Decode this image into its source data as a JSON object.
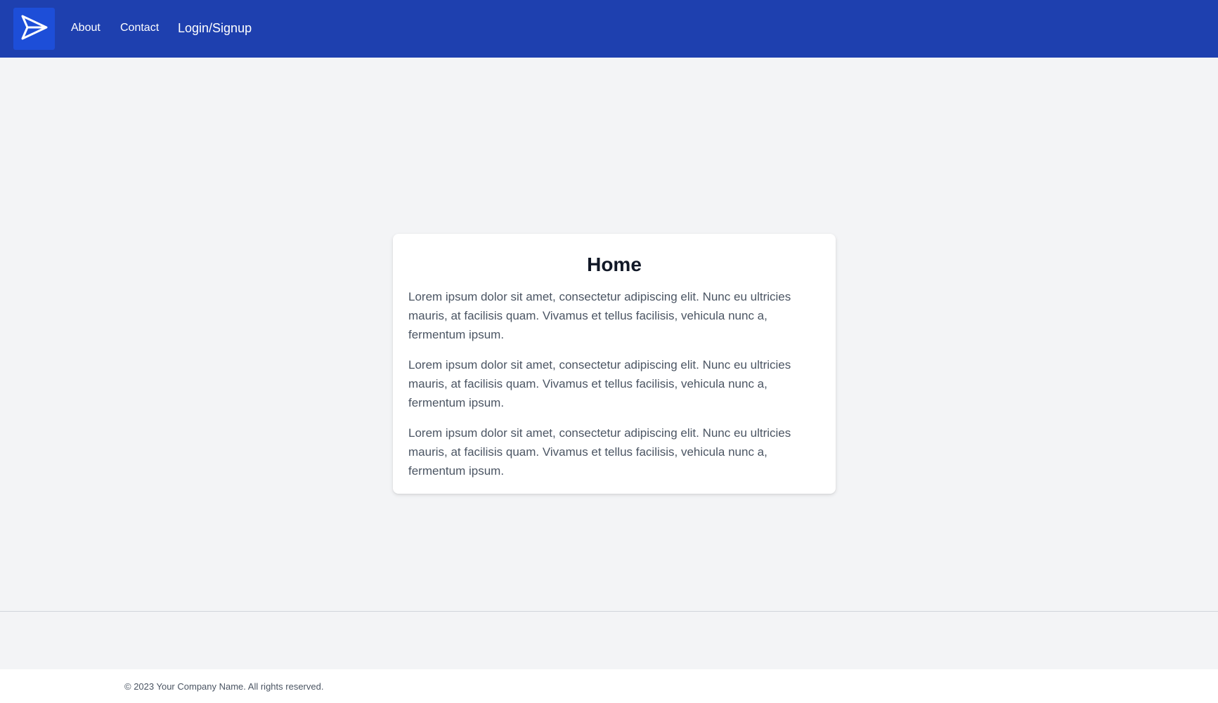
{
  "header": {
    "brand_color": "#1e40af",
    "logo_icon": "paper-plane-icon",
    "nav": {
      "about": "About",
      "contact": "Contact",
      "login_signup": "Login/Signup"
    }
  },
  "main": {
    "title": "Home",
    "paragraphs": [
      "Lorem ipsum dolor sit amet, consectetur adipiscing elit. Nunc eu ultricies mauris, at facilisis quam. Vivamus et tellus facilisis, vehicula nunc a, fermentum ipsum.",
      "Lorem ipsum dolor sit amet, consectetur adipiscing elit. Nunc eu ultricies mauris, at facilisis quam. Vivamus et tellus facilisis, vehicula nunc a, fermentum ipsum.",
      "Lorem ipsum dolor sit amet, consectetur adipiscing elit. Nunc eu ultricies mauris, at facilisis quam. Vivamus et tellus facilisis, vehicula nunc a, fermentum ipsum."
    ]
  },
  "footer": {
    "copyright": "© 2023 Your Company Name. All rights reserved."
  }
}
